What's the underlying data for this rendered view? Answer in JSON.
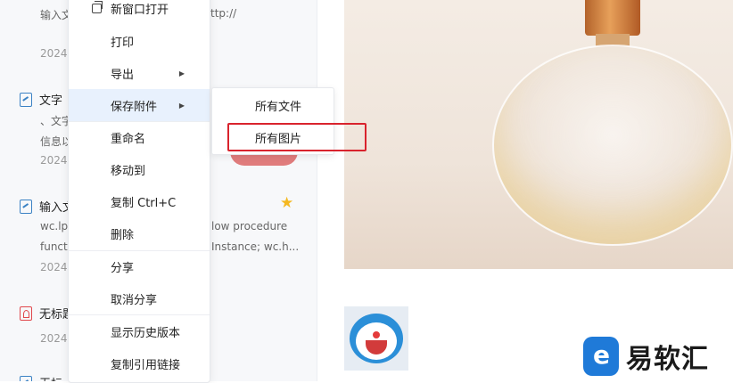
{
  "note_list": {
    "notes": [
      {
        "title": "",
        "snippet": "输入文",
        "date": "2024-"
      },
      {
        "title": "文字",
        "snippet": "、文字",
        "snippet2": "信息以",
        "date": "2024-"
      },
      {
        "title": "输入文",
        "snippet": "wc.lp",
        "snippet2": "functi",
        "date": "2024-"
      },
      {
        "title": "无标题",
        "date": "2024-"
      },
      {
        "title": "无标"
      }
    ],
    "peek_texts": {
      "url": "ttp://",
      "line1": "low procedure",
      "line2": "Instance; wc.h..."
    }
  },
  "context_menu": {
    "items": [
      {
        "label": "新窗口打开"
      },
      {
        "label": "打印"
      },
      {
        "label": "导出"
      },
      {
        "label": "保存附件"
      },
      {
        "label": "重命名"
      },
      {
        "label": "移动到"
      },
      {
        "label": "复制 Ctrl+C"
      },
      {
        "label": "删除"
      },
      {
        "label": "分享"
      },
      {
        "label": "取消分享"
      },
      {
        "label": "显示历史版本"
      },
      {
        "label": "复制引用链接"
      }
    ]
  },
  "submenu": {
    "items": [
      {
        "label": "所有文件"
      },
      {
        "label": "所有图片"
      }
    ]
  },
  "watermark": {
    "text": "易软汇"
  },
  "colors": {
    "highlight_box": "#d9232d",
    "active_item_bg": "#e8f1fd",
    "accent": "#1f7ad8"
  }
}
